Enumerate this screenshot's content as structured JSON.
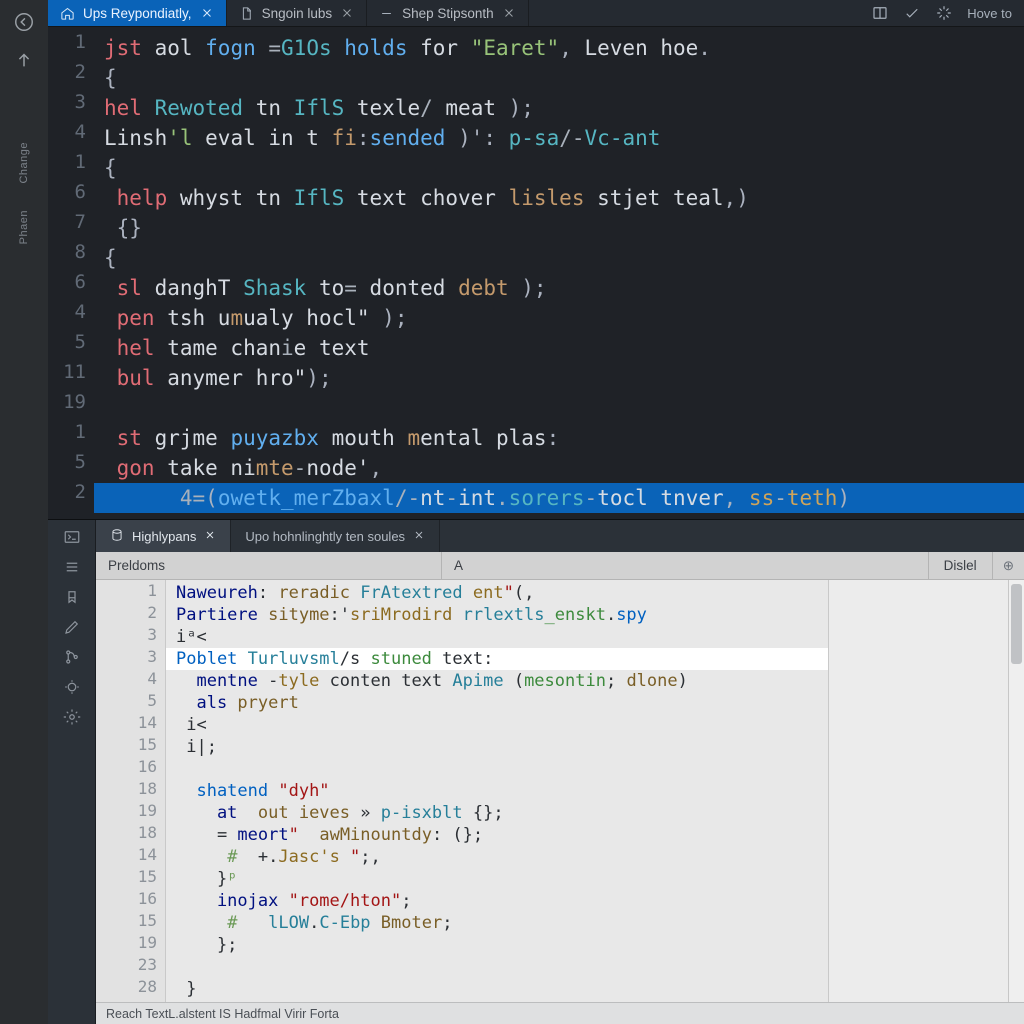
{
  "activity": {
    "labels": [
      "Change",
      "Phaen"
    ]
  },
  "tabs": {
    "items": [
      {
        "label": "Ups Reypondiatly,",
        "icon": "home"
      },
      {
        "label": "Sngoin lubs",
        "icon": "file"
      },
      {
        "label": "Shep Stipsonth",
        "icon": "dash"
      }
    ],
    "tools_label": "Hove to"
  },
  "editor_dark": {
    "gutter": [
      "1",
      "2",
      "3",
      "4",
      "1",
      "6",
      "7",
      "8",
      "6",
      "4",
      "5",
      "11",
      "19",
      "1",
      "5",
      "2"
    ],
    "lines": [
      {
        "t": [
          [
            "kw",
            "jst"
          ],
          [
            "ident",
            " aol "
          ],
          [
            "fn",
            "fogn "
          ],
          [
            "op",
            "="
          ],
          [
            "type",
            "G1Os "
          ],
          [
            "fn",
            "holds "
          ],
          [
            "ident",
            "for "
          ],
          [
            "str",
            "\"Earet\""
          ],
          [
            "punc",
            ", "
          ],
          [
            "ident",
            "Leven hoe"
          ],
          [
            "punc",
            "."
          ]
        ]
      },
      {
        "t": [
          [
            "punc",
            "{"
          ]
        ]
      },
      {
        "t": [
          [
            "kw",
            "hel "
          ],
          [
            "type",
            "Rewoted "
          ],
          [
            "ident",
            "tn "
          ],
          [
            "type",
            "IflS "
          ],
          [
            "ident",
            "texle"
          ],
          [
            "op",
            "/"
          ],
          [
            "ident",
            " meat "
          ],
          [
            "punc",
            ");"
          ]
        ]
      },
      {
        "t": [
          [
            "ident",
            "Linsh"
          ],
          [
            "str",
            "'l"
          ],
          [
            "ident",
            " eval in t "
          ],
          [
            "var",
            "fi"
          ],
          [
            "punc",
            ":"
          ],
          [
            "fn",
            "sended "
          ],
          [
            "punc",
            ")'"
          ],
          [
            "punc",
            ": "
          ],
          [
            "type",
            "p-sa"
          ],
          [
            "op",
            "/-"
          ],
          [
            "type",
            "Vc-ant"
          ]
        ]
      },
      {
        "t": [
          [
            "punc",
            "{"
          ]
        ]
      },
      {
        "t": [
          [
            "kw",
            " help "
          ],
          [
            "ident",
            "whyst tn "
          ],
          [
            "type",
            "IflS"
          ],
          [
            "ident",
            " text chover "
          ],
          [
            "var",
            "lisles"
          ],
          [
            "ident",
            " stjet teal"
          ],
          [
            "punc",
            ",)"
          ]
        ]
      },
      {
        "t": [
          [
            "punc",
            " {}"
          ]
        ]
      },
      {
        "t": [
          [
            "punc",
            "{"
          ]
        ]
      },
      {
        "t": [
          [
            "kw",
            " sl "
          ],
          [
            "ident",
            "danghT "
          ],
          [
            "type",
            "Shask"
          ],
          [
            "ident",
            " to"
          ],
          [
            "op",
            "="
          ],
          [
            "ident",
            " donted "
          ],
          [
            "var",
            "debt "
          ],
          [
            "punc",
            ");"
          ]
        ]
      },
      {
        "t": [
          [
            "kw",
            " pen "
          ],
          [
            "ident",
            "tsh u"
          ],
          [
            "var",
            "m"
          ],
          [
            "ident",
            "ualy hocl\" "
          ],
          [
            "punc",
            ");"
          ]
        ]
      },
      {
        "t": [
          [
            "kw",
            " hel "
          ],
          [
            "ident",
            "tame chan"
          ],
          [
            "op",
            "i"
          ],
          [
            "ident",
            "e text"
          ]
        ]
      },
      {
        "t": [
          [
            "kw",
            " bul "
          ],
          [
            "ident",
            "anymer hro\""
          ],
          [
            "punc",
            ");"
          ]
        ]
      },
      {
        "t": [
          [
            "ident",
            " "
          ]
        ]
      },
      {
        "t": [
          [
            "kw",
            " st "
          ],
          [
            "ident",
            "grjme "
          ],
          [
            "fn",
            "puyazbx"
          ],
          [
            "ident",
            " mouth "
          ],
          [
            "var",
            "m"
          ],
          [
            "ident",
            "ental plas"
          ],
          [
            "punc",
            ":"
          ]
        ]
      },
      {
        "t": [
          [
            "kw",
            " gon "
          ],
          [
            "ident",
            "take ni"
          ],
          [
            "var",
            "mte"
          ],
          [
            "op",
            "-"
          ],
          [
            "ident",
            "node'"
          ],
          [
            "punc",
            ","
          ]
        ]
      },
      {
        "hl": true,
        "t": [
          [
            "op",
            "      4="
          ],
          [
            "punc",
            "("
          ],
          [
            "fn",
            "owetk_merZbaxl"
          ],
          [
            "op",
            "/-"
          ],
          [
            "ident",
            "nt"
          ],
          [
            "op",
            "-"
          ],
          [
            "ident",
            "int"
          ],
          [
            "op",
            "."
          ],
          [
            "type",
            "sorers"
          ],
          [
            "op",
            "-"
          ],
          [
            "ident",
            "tocl tnver"
          ],
          [
            "punc",
            ", "
          ],
          [
            "param",
            "ss"
          ],
          [
            "op",
            "-"
          ],
          [
            "param",
            "teth"
          ],
          [
            "punc",
            ")"
          ]
        ]
      }
    ]
  },
  "panel": {
    "tabs": [
      {
        "label": "Highlypans",
        "active": true
      },
      {
        "label": "Upo hohnlinghtly ten soules",
        "active": false
      }
    ],
    "header": {
      "col1": "Preldoms",
      "col2": "A",
      "col3": "Dislel"
    },
    "gutter": [
      "1",
      "2",
      "3",
      "3",
      "4",
      "5",
      "14",
      "15",
      "16",
      "18",
      "19",
      "18",
      "14",
      "15",
      "16",
      "15",
      "19",
      "23",
      "28"
    ],
    "lines": [
      {
        "t": [
          [
            "id",
            "Naweureh"
          ],
          [
            "punc",
            ": "
          ],
          [
            "fn",
            "reradic "
          ],
          [
            "type",
            "FrAtextred "
          ],
          [
            "br",
            "ent"
          ],
          [
            "red",
            "\""
          ],
          [
            "punc",
            "(,"
          ]
        ]
      },
      {
        "t": [
          [
            "id",
            "Partiere "
          ],
          [
            "fn",
            "sityme"
          ],
          [
            "punc",
            ":'"
          ],
          [
            "br",
            "sriMrodird "
          ],
          [
            "type",
            "rrlextls"
          ],
          [
            "grn",
            "_enskt"
          ],
          [
            "punc",
            "."
          ],
          [
            "kw",
            "spy"
          ]
        ]
      },
      {
        "t": [
          [
            "punc",
            "iᵃ<"
          ]
        ]
      },
      {
        "hl": true,
        "t": [
          [
            "kw",
            "Poblet "
          ],
          [
            "type",
            "Turluvsml"
          ],
          [
            "punc",
            "/s "
          ],
          [
            "grn",
            "stuned"
          ],
          [
            "punc",
            " text"
          ],
          [
            "punc",
            ":"
          ]
        ]
      },
      {
        "t": [
          [
            "id",
            "  mentne "
          ],
          [
            "punc",
            "-"
          ],
          [
            "br",
            "tyle "
          ],
          [
            "punc",
            "conten text "
          ],
          [
            "type",
            "Apime "
          ],
          [
            "punc",
            "("
          ],
          [
            "grn",
            "mesontin"
          ],
          [
            "punc",
            "; "
          ],
          [
            "fn",
            "dlone"
          ],
          [
            "punc",
            ")"
          ]
        ]
      },
      {
        "t": [
          [
            "id",
            "  als "
          ],
          [
            "fn",
            "pryert"
          ]
        ]
      },
      {
        "t": [
          [
            "punc",
            " i<"
          ]
        ]
      },
      {
        "t": [
          [
            "punc",
            " i|;"
          ]
        ]
      },
      {
        "t": [
          [
            "punc",
            " "
          ]
        ]
      },
      {
        "t": [
          [
            "kw",
            "  shatend "
          ],
          [
            "red",
            "\"dyh\""
          ]
        ]
      },
      {
        "t": [
          [
            "id",
            "    at  "
          ],
          [
            "fn",
            "out ieves "
          ],
          [
            "punc",
            "» "
          ],
          [
            "type",
            "p-isxblt "
          ],
          [
            "punc",
            "{};"
          ]
        ]
      },
      {
        "t": [
          [
            "punc",
            "    = "
          ],
          [
            "id",
            "meort"
          ],
          [
            "red",
            "\""
          ],
          [
            "punc",
            "  "
          ],
          [
            "fn",
            "awMinountdy"
          ],
          [
            "punc",
            ": (};"
          ]
        ]
      },
      {
        "t": [
          [
            "punc",
            "     "
          ],
          [
            "com",
            "#"
          ],
          [
            "punc",
            "  +."
          ],
          [
            "br",
            "Jasc's "
          ],
          [
            "red",
            "\""
          ],
          [
            "punc",
            ";,"
          ]
        ]
      },
      {
        "t": [
          [
            "punc",
            "    }"
          ],
          [
            "com",
            "ᵖ"
          ]
        ]
      },
      {
        "t": [
          [
            "id",
            "    inojax "
          ],
          [
            "red",
            "\"rome/hton\""
          ],
          [
            "punc",
            ";"
          ]
        ]
      },
      {
        "t": [
          [
            "punc",
            "     "
          ],
          [
            "com",
            "#"
          ],
          [
            "punc",
            "   "
          ],
          [
            "type",
            "lLOW"
          ],
          [
            "punc",
            "."
          ],
          [
            "type",
            "C-Ebp "
          ],
          [
            "fn",
            "Bmoter"
          ],
          [
            "punc",
            ";"
          ]
        ]
      },
      {
        "t": [
          [
            "punc",
            "    };"
          ]
        ]
      },
      {
        "t": [
          [
            "punc",
            " "
          ]
        ]
      },
      {
        "t": [
          [
            "punc",
            " }"
          ]
        ]
      }
    ]
  },
  "status": {
    "text": "Reach TextL.alstent IS  Hadfmal Virir Forta"
  }
}
